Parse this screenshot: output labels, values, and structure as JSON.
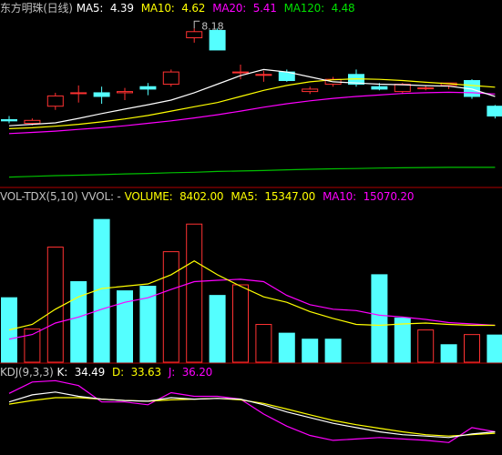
{
  "price_header": {
    "title": "东方明珠(日线)",
    "ma5_label": "MA5:",
    "ma5_value": "4.39",
    "ma10_label": "MA10:",
    "ma10_value": "4.62",
    "ma20_label": "MA20:",
    "ma20_value": "5.41",
    "ma120_label": "MA120:",
    "ma120_value": "4.48"
  },
  "high_marker": "8.18",
  "vol_header": {
    "title": "VOL-TDX(5,10)",
    "vvol": "VVOL: -",
    "volume_label": "VOLUME:",
    "volume_value": "8402.00",
    "ma5_label": "MA5:",
    "ma5_value": "15347.00",
    "ma10_label": "MA10:",
    "ma10_value": "15070.20"
  },
  "kdj_header": {
    "title": "KDJ(9,3,3)",
    "k_label": "K:",
    "k_value": "34.49",
    "d_label": "D:",
    "d_value": "33.63",
    "j_label": "J:",
    "j_value": "36.20"
  },
  "colors": {
    "up": "#ff3232",
    "down": "#54ffff",
    "ma5": "#ffffff",
    "ma10": "#ffff00",
    "ma20": "#ff00ff",
    "ma120": "#00c000",
    "divider": "#b00000"
  },
  "chart_data": [
    {
      "type": "candlestick",
      "title": "东方明珠(日线)",
      "note": "values in price units read from the chart; no price axis labels shown",
      "candles": [
        {
          "o": 4.45,
          "h": 4.6,
          "l": 4.3,
          "c": 4.4
        },
        {
          "o": 4.3,
          "h": 4.5,
          "l": 4.22,
          "c": 4.42
        },
        {
          "o": 5.0,
          "h": 5.55,
          "l": 4.85,
          "c": 5.42
        },
        {
          "o": 5.52,
          "h": 5.85,
          "l": 5.15,
          "c": 5.55
        },
        {
          "o": 5.55,
          "h": 5.8,
          "l": 5.1,
          "c": 5.4
        },
        {
          "o": 5.55,
          "h": 5.75,
          "l": 5.25,
          "c": 5.6
        },
        {
          "o": 5.8,
          "h": 5.95,
          "l": 5.45,
          "c": 5.7
        },
        {
          "o": 5.9,
          "h": 6.5,
          "l": 5.8,
          "c": 6.4
        },
        {
          "o": 7.8,
          "h": 8.18,
          "l": 7.6,
          "c": 8.05
        },
        {
          "o": 8.1,
          "h": 8.18,
          "l": 7.3,
          "c": 7.3
        },
        {
          "o": 6.4,
          "h": 6.7,
          "l": 6.1,
          "c": 6.4
        },
        {
          "o": 6.3,
          "h": 6.45,
          "l": 6.0,
          "c": 6.3
        },
        {
          "o": 6.4,
          "h": 6.5,
          "l": 6.0,
          "c": 6.05
        },
        {
          "o": 5.6,
          "h": 5.8,
          "l": 5.5,
          "c": 5.7
        },
        {
          "o": 5.9,
          "h": 6.2,
          "l": 5.8,
          "c": 6.1
        },
        {
          "o": 6.3,
          "h": 6.5,
          "l": 5.8,
          "c": 5.9
        },
        {
          "o": 5.8,
          "h": 5.95,
          "l": 5.65,
          "c": 5.7
        },
        {
          "o": 5.6,
          "h": 5.95,
          "l": 5.5,
          "c": 5.9
        },
        {
          "o": 5.75,
          "h": 5.85,
          "l": 5.65,
          "c": 5.75
        },
        {
          "o": 5.85,
          "h": 5.95,
          "l": 5.7,
          "c": 5.95
        },
        {
          "o": 6.05,
          "h": 6.1,
          "l": 5.3,
          "c": 5.4
        },
        {
          "o": 5.0,
          "h": 5.05,
          "l": 4.5,
          "c": 4.6
        }
      ],
      "ma5": [
        4.2,
        4.26,
        4.32,
        4.5,
        4.7,
        4.88,
        5.06,
        5.25,
        5.55,
        5.9,
        6.25,
        6.5,
        6.4,
        6.2,
        6.0,
        5.95,
        5.9,
        5.88,
        5.84,
        5.82,
        5.7,
        5.4
      ],
      "ma10": [
        4.08,
        4.12,
        4.18,
        4.26,
        4.36,
        4.48,
        4.62,
        4.8,
        4.98,
        5.15,
        5.4,
        5.65,
        5.85,
        6.0,
        6.08,
        6.12,
        6.1,
        6.05,
        5.98,
        5.92,
        5.85,
        5.78
      ],
      "ma20": [
        3.88,
        3.93,
        3.98,
        4.05,
        4.12,
        4.2,
        4.3,
        4.4,
        4.52,
        4.65,
        4.8,
        4.96,
        5.1,
        5.22,
        5.32,
        5.4,
        5.46,
        5.52,
        5.55,
        5.57,
        5.55,
        5.5
      ],
      "ma120": [
        2.1,
        2.13,
        2.16,
        2.18,
        2.2,
        2.23,
        2.25,
        2.28,
        2.3,
        2.33,
        2.35,
        2.37,
        2.4,
        2.42,
        2.44,
        2.45,
        2.47,
        2.48,
        2.49,
        2.5,
        2.5,
        2.5
      ],
      "ylim": [
        1.9,
        8.6
      ]
    },
    {
      "type": "bar",
      "title": "VOL-TDX(5,10)",
      "volumes": [
        14000,
        7200,
        25000,
        17500,
        31000,
        15500,
        16500,
        24000,
        30000,
        14500,
        16800,
        8200,
        6300,
        5000,
        5000,
        0,
        19000,
        9600,
        7000,
        3800,
        6000,
        5900
      ],
      "up": [
        false,
        true,
        true,
        false,
        false,
        false,
        false,
        true,
        true,
        false,
        true,
        true,
        false,
        false,
        false,
        false,
        false,
        false,
        true,
        false,
        true,
        false
      ],
      "ma5": [
        7000,
        8200,
        11500,
        14200,
        16000,
        16500,
        17000,
        19000,
        22000,
        19000,
        16500,
        14200,
        13000,
        11000,
        9500,
        8200,
        8000,
        8300,
        8500,
        8200,
        8000,
        8000
      ],
      "ma10": [
        5000,
        6000,
        8500,
        9800,
        11500,
        13000,
        14000,
        15800,
        17500,
        17800,
        18000,
        17500,
        14500,
        12500,
        11500,
        11200,
        10200,
        9800,
        9300,
        8600,
        8300,
        8000
      ],
      "ylim": [
        0,
        34000
      ]
    },
    {
      "type": "line",
      "title": "KDJ(9,3,3)",
      "k": [
        72,
        82,
        86,
        80,
        76,
        74,
        73,
        78,
        76,
        77,
        76,
        68,
        58,
        50,
        42,
        36,
        30,
        26,
        24,
        22,
        27,
        30
      ],
      "d": [
        69,
        74,
        78,
        78,
        76,
        74,
        73,
        75,
        76,
        77,
        75,
        70,
        62,
        54,
        46,
        40,
        35,
        30,
        26,
        24,
        26,
        28
      ],
      "j": [
        84,
        100,
        102,
        95,
        72,
        72,
        68,
        85,
        80,
        80,
        76,
        55,
        38,
        25,
        18,
        20,
        22,
        20,
        18,
        15,
        36,
        30
      ],
      "ylim": [
        0,
        110
      ]
    }
  ]
}
